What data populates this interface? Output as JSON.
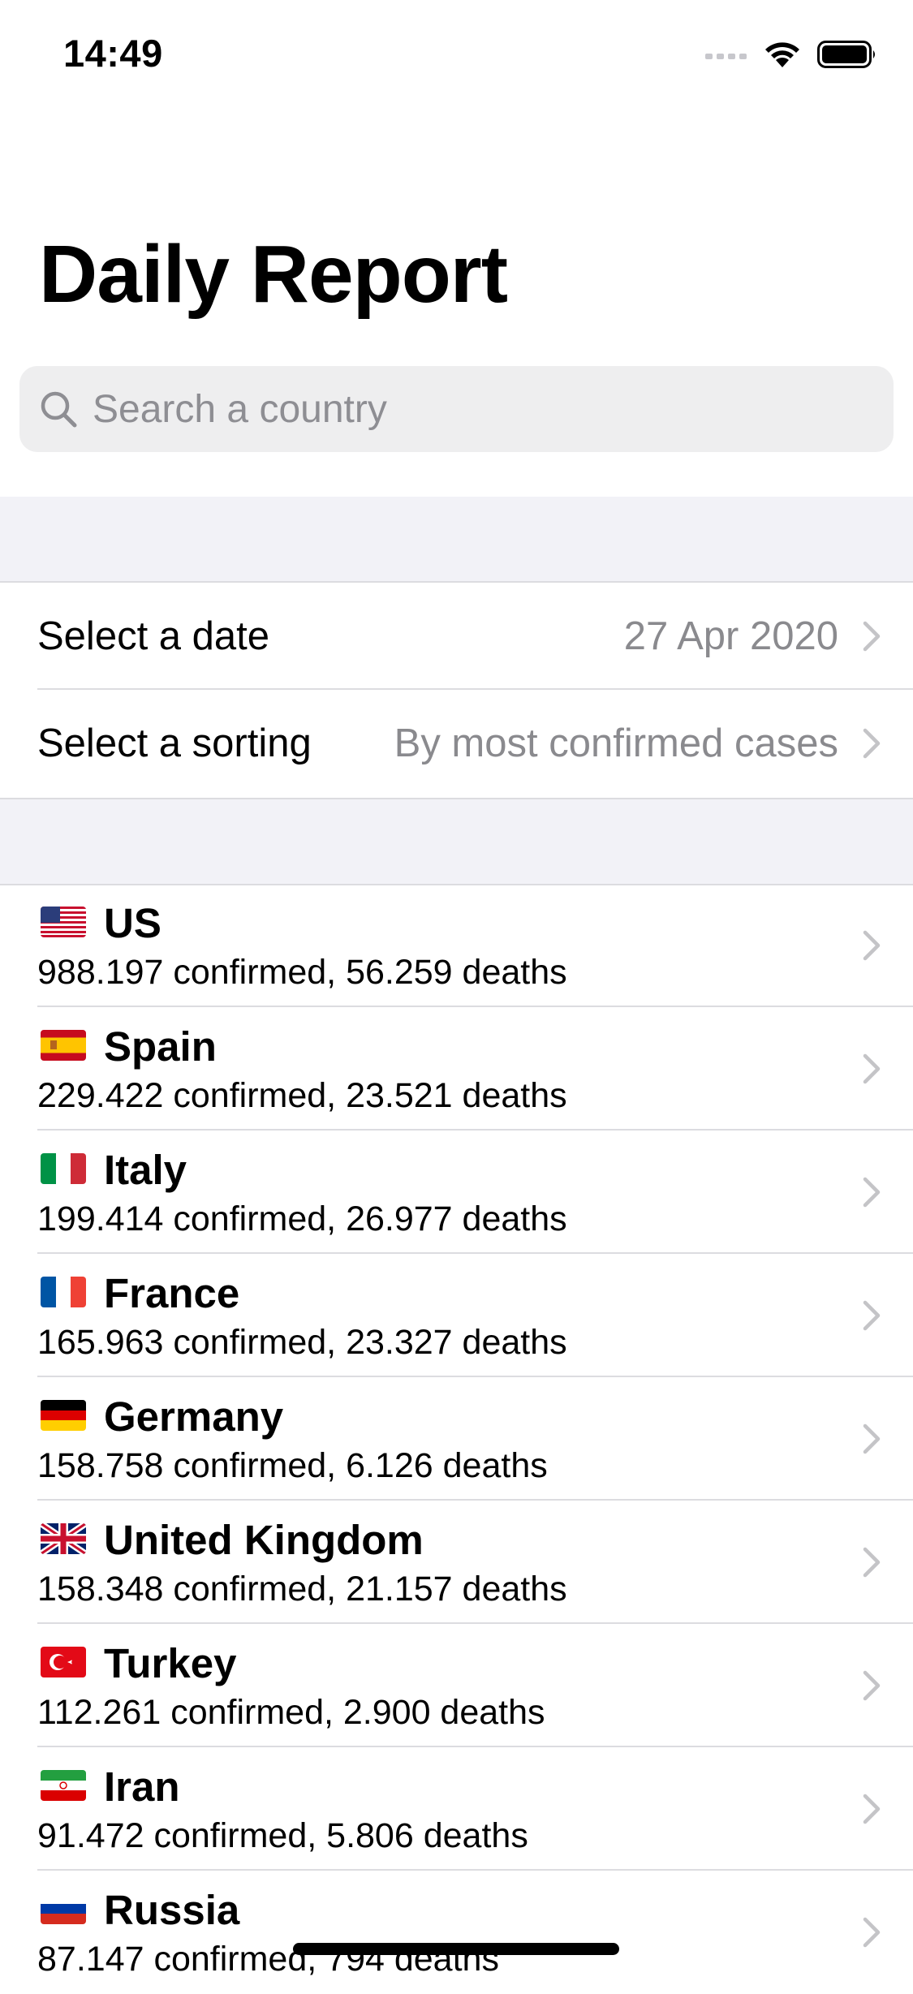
{
  "status_bar": {
    "time": "14:49",
    "icons": [
      "signal-icon",
      "wifi-icon",
      "battery-icon"
    ]
  },
  "header": {
    "title": "Daily Report"
  },
  "search": {
    "placeholder": "Search a country",
    "value": ""
  },
  "settings": {
    "date": {
      "label": "Select a date",
      "value": "27 Apr 2020"
    },
    "sorting": {
      "label": "Select a sorting",
      "value": "By most confirmed cases"
    }
  },
  "countries": [
    {
      "name": "US",
      "stats": "988.197 confirmed, 56.259 deaths",
      "flag": "us"
    },
    {
      "name": "Spain",
      "stats": "229.422 confirmed, 23.521 deaths",
      "flag": "es"
    },
    {
      "name": "Italy",
      "stats": "199.414 confirmed, 26.977 deaths",
      "flag": "it"
    },
    {
      "name": "France",
      "stats": "165.963 confirmed, 23.327 deaths",
      "flag": "fr"
    },
    {
      "name": "Germany",
      "stats": "158.758 confirmed, 6.126 deaths",
      "flag": "de"
    },
    {
      "name": "United Kingdom",
      "stats": "158.348 confirmed, 21.157 deaths",
      "flag": "gb"
    },
    {
      "name": "Turkey",
      "stats": "112.261 confirmed, 2.900 deaths",
      "flag": "tr"
    },
    {
      "name": "Iran",
      "stats": "91.472 confirmed, 5.806 deaths",
      "flag": "ir"
    },
    {
      "name": "Russia",
      "stats": "87.147 confirmed, 794 deaths",
      "flag": "ru"
    }
  ],
  "colors": {
    "background": "#ffffff",
    "grouped_background": "#f2f2f7",
    "secondary_text": "#8a8a8e",
    "separator": "#dcdce0",
    "chevron": "#c4c4c7"
  }
}
